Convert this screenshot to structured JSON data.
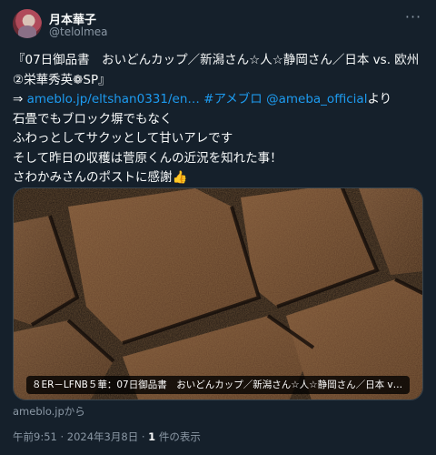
{
  "author": {
    "name": "月本華子",
    "handle": "@telolmea"
  },
  "tweet": {
    "line1": "『07日御品書　おいどんカップ／新潟さん☆人☆静岡さん／日本 vs. 欧州②栄華秀英❁SP』",
    "arrow": "⇒ ",
    "link1": "ameblo.jp/eltshan0331/en…",
    "space1": " ",
    "link2": "#アメブロ",
    "space2": " ",
    "link3": "@ameba_official",
    "suffix": "より",
    "body": "石畳でもブロック塀でもなく\nふわっとしてサクッとして甘いアレです\nそして昨日の収穫は菅原くんの近況を知れた事！\nさわかみさんのポストに感謝👍"
  },
  "media": {
    "caption": "８ER－LFNB５華：07日御品書　おいどんカップ／新潟さん☆人☆静岡さん／日本 vs. 欧州…"
  },
  "source": "ameblo.jpから",
  "meta": {
    "time": "午前9:51 · 2024年3月8日 · ",
    "views_count": "1",
    "views_label": " 件の表示"
  },
  "colors": {
    "background": "#15202b",
    "link": "#1d9bf0",
    "secondary_text": "#8b98a5"
  },
  "icons": {
    "more": "more-horizontal-icon"
  }
}
